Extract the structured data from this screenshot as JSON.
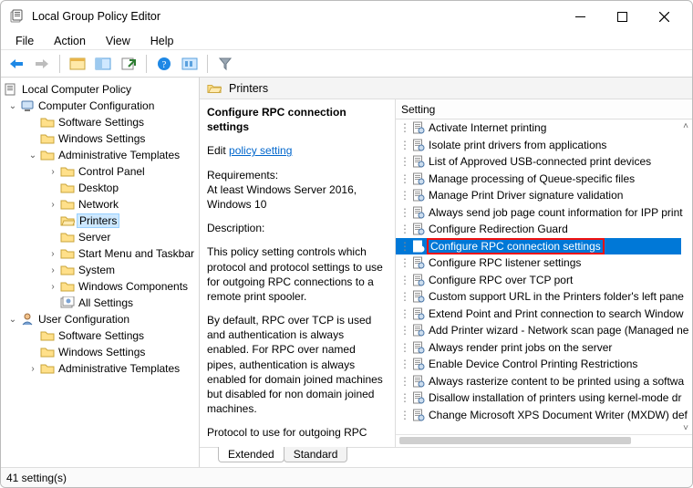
{
  "window_title": "Local Group Policy Editor",
  "menu": {
    "file": "File",
    "action": "Action",
    "view": "View",
    "help": "Help"
  },
  "tabs": {
    "extended": "Extended",
    "standard": "Standard"
  },
  "status": "41 setting(s)",
  "breadcrumb": "Printers",
  "list_header": "Setting",
  "detail": {
    "title": "Configure RPC connection settings",
    "edit_prefix": "Edit ",
    "edit_link": "policy setting ",
    "req_label": "Requirements:",
    "req_body": "At least Windows Server 2016, Windows 10",
    "desc_label": "Description:",
    "desc_p1": "This policy setting controls which protocol and protocol settings to use for outgoing RPC connections to a remote print spooler.",
    "desc_p2": "By default, RPC over TCP is used and authentication is always enabled. For RPC over named pipes, authentication is always enabled for domain joined machines but disabled for non domain joined machines.",
    "desc_p3": "Protocol to use for outgoing RPC"
  },
  "tree": {
    "root": "Local Computer Policy",
    "cc": "Computer Configuration",
    "cc_children": [
      "Software Settings",
      "Windows Settings"
    ],
    "at": "Administrative Templates",
    "at_children": [
      "Control Panel",
      "Desktop",
      "Network",
      "Printers",
      "Server",
      "Start Menu and Taskbar",
      "System",
      "Windows Components",
      "All Settings"
    ],
    "uc": "User Configuration",
    "uc_children": [
      "Software Settings",
      "Windows Settings",
      "Administrative Templates"
    ]
  },
  "settings": [
    "Activate Internet printing",
    "Isolate print drivers from applications",
    "List of Approved USB-connected print devices",
    "Manage processing of Queue-specific files",
    "Manage Print Driver signature validation",
    "Always send job page count information for IPP print",
    "Configure Redirection Guard",
    "Configure RPC connection settings",
    "Configure RPC listener settings",
    "Configure RPC over TCP port",
    "Custom support URL in the Printers folder's left pane",
    "Extend Point and Print connection to search Window",
    "Add Printer wizard - Network scan page (Managed ne",
    "Always render print jobs on the server",
    "Enable Device Control Printing Restrictions",
    "Always rasterize content to be printed using a softwa",
    "Disallow installation of printers using kernel-mode dr",
    "Change Microsoft XPS Document Writer (MXDW) def"
  ],
  "selected_setting_index": 7
}
